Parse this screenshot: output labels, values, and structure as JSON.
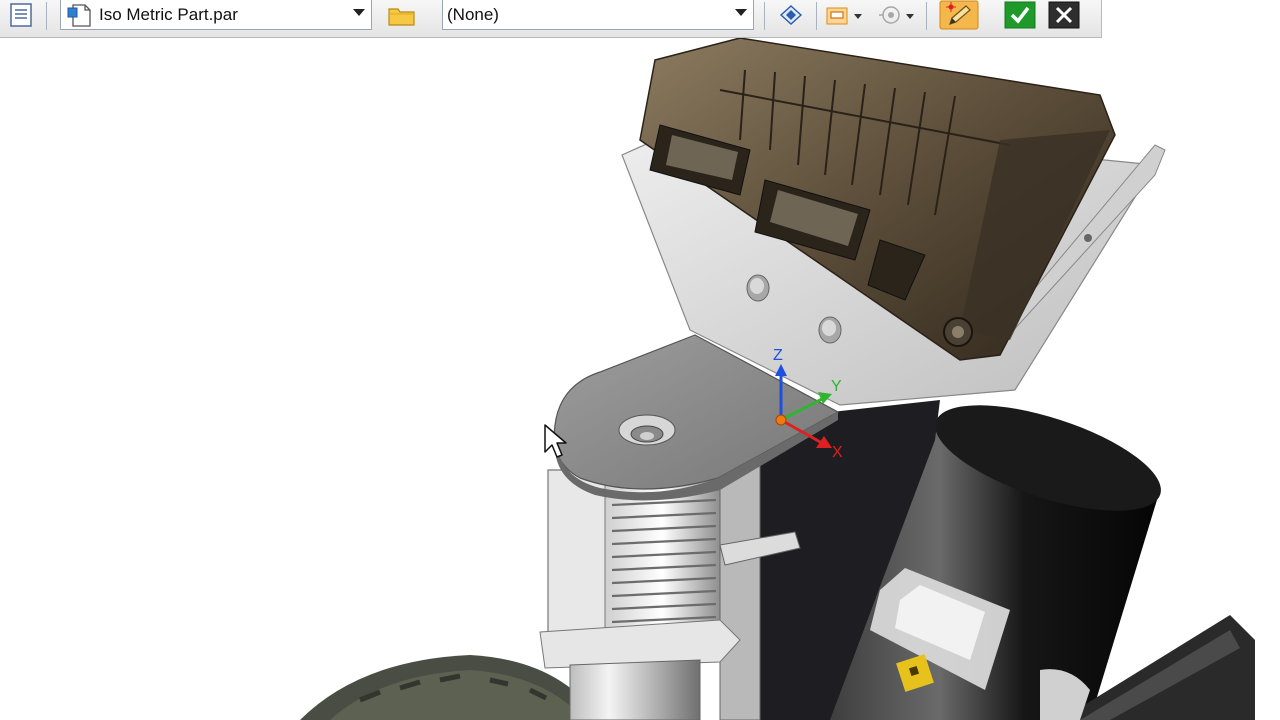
{
  "toolbar": {
    "part_file": "Iso Metric Part.par",
    "material": "(None)"
  },
  "triad": {
    "z": "Z",
    "y": "Y",
    "x": "X"
  },
  "colors": {
    "accept": "#1f9a2a",
    "cancel": "#2e2e2e",
    "axis_x": "#e02020",
    "axis_y": "#2fb52f",
    "axis_z": "#1f4fe0"
  }
}
